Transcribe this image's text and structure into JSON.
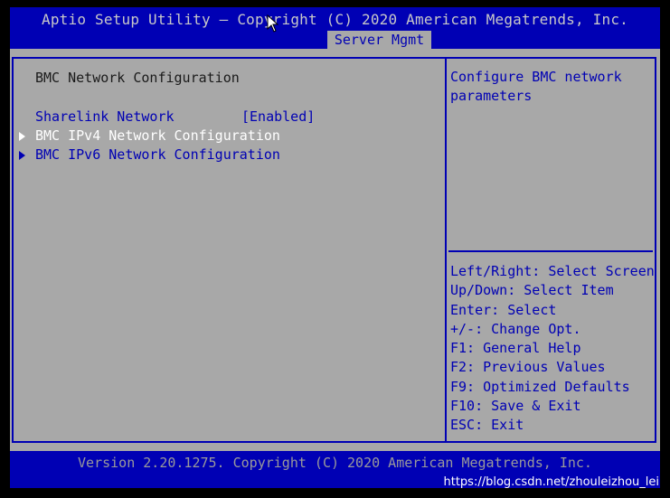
{
  "header": {
    "title": "Aptio Setup Utility – Copyright (C) 2020 American Megatrends, Inc.",
    "active_tab": "Server Mgmt"
  },
  "main": {
    "section_title": "BMC Network Configuration",
    "items": [
      {
        "label": "Sharelink Network",
        "value": "[Enabled]",
        "selected": false,
        "submenu": false
      },
      {
        "label": "BMC IPv4 Network Configuration",
        "selected": true,
        "submenu": true
      },
      {
        "label": "BMC IPv6 Network Configuration",
        "selected": false,
        "submenu": true
      }
    ]
  },
  "help": {
    "text": "Configure BMC network parameters",
    "keys": [
      "Left/Right: Select Screen",
      "Up/Down: Select Item",
      "Enter: Select",
      "+/-: Change Opt.",
      "F1: General Help",
      "F2: Previous Values",
      "F9: Optimized Defaults",
      "F10: Save & Exit",
      "ESC: Exit"
    ]
  },
  "footer": {
    "version": "Version 2.20.1275. Copyright (C) 2020 American Megatrends, Inc.",
    "watermark": "https://blog.csdn.net/zhouleizhou_lei"
  },
  "colors": {
    "bios_blue": "#0000b4",
    "bios_gray": "#a8a8a8",
    "selected_text": "#ffffff"
  }
}
